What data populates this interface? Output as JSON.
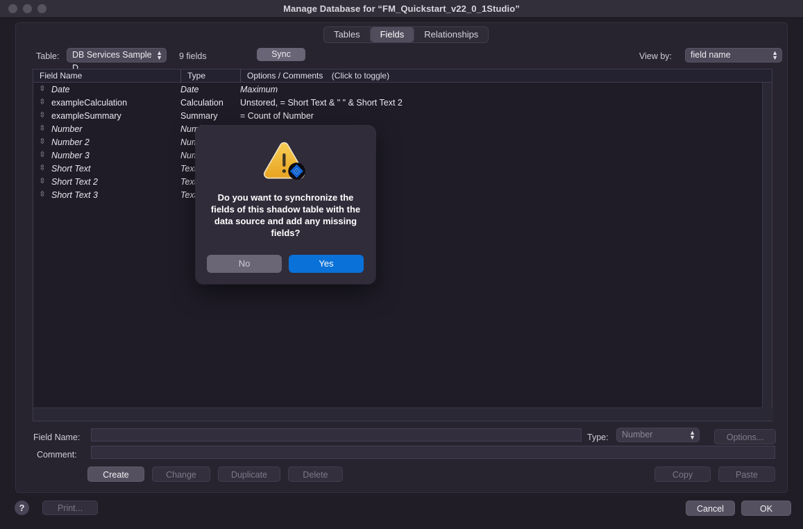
{
  "window": {
    "title": "Manage Database for “FM_Quickstart_v22_0_1Studio”",
    "traffic_lights": [
      "close",
      "minimize",
      "zoom"
    ]
  },
  "tabs": [
    {
      "label": "Tables",
      "active": false
    },
    {
      "label": "Fields",
      "active": true
    },
    {
      "label": "Relationships",
      "active": false
    }
  ],
  "toolbar": {
    "table_label": "Table:",
    "table_selected": "DB Services Sample D...",
    "fields_count": "9 fields",
    "sync_label": "Sync",
    "viewby_label": "View by:",
    "viewby_selected": "field name",
    "stepper_glyph": "⌃⌄"
  },
  "list": {
    "headers": {
      "field_name": "Field Name",
      "type": "Type",
      "options": "Options / Comments",
      "options_hint": "(Click to toggle)"
    },
    "drag_handle_glyph": "⇳",
    "rows": [
      {
        "name": "Date",
        "type": "Date",
        "options": "Maximum",
        "italic": true
      },
      {
        "name": "exampleCalculation",
        "type": "Calculation",
        "options": "Unstored, = Short Text & \" \" & Short Text 2",
        "italic": false
      },
      {
        "name": "exampleSummary",
        "type": "Summary",
        "options": "= Count of Number",
        "italic": false
      },
      {
        "name": "Number",
        "type": "Number",
        "options": "",
        "italic": true
      },
      {
        "name": "Number 2",
        "type": "Number",
        "options": "",
        "italic": true
      },
      {
        "name": "Number 3",
        "type": "Number",
        "options": "",
        "italic": true
      },
      {
        "name": "Short Text",
        "type": "Text",
        "options": "",
        "italic": true
      },
      {
        "name": "Short Text 2",
        "type": "Text",
        "options": "",
        "italic": true
      },
      {
        "name": "Short Text 3",
        "type": "Text",
        "options": "",
        "italic": true
      }
    ]
  },
  "form": {
    "field_name_label": "Field Name:",
    "field_name_value": "",
    "type_label": "Type:",
    "type_value": "Number",
    "options_label": "Options...",
    "comment_label": "Comment:",
    "comment_value": ""
  },
  "action_buttons": [
    {
      "label": "Create",
      "enabled": true
    },
    {
      "label": "Change",
      "enabled": false
    },
    {
      "label": "Duplicate",
      "enabled": false
    },
    {
      "label": "Delete",
      "enabled": false
    },
    {
      "label": "Copy",
      "enabled": false
    },
    {
      "label": "Paste",
      "enabled": false
    }
  ],
  "footer": {
    "help_label": "?",
    "print_label": "Print...",
    "cancel_label": "Cancel",
    "ok_label": "OK"
  },
  "alert": {
    "icon": "warning-triangle-with-filemaker-badge",
    "message": "Do you want to synchronize the fields of this shadow table with the data source and add any missing fields?",
    "no_label": "No",
    "yes_label": "Yes"
  },
  "colors": {
    "window_bg": "#201d26",
    "titlebar": "#322f3a",
    "panel": "#272430",
    "list_bg": "#1f1c28",
    "accent_blue": "#0a71d8",
    "warning_yellow": "#f0b429",
    "text_primary": "#e9e6ef",
    "text_disabled": "#7d798a"
  }
}
